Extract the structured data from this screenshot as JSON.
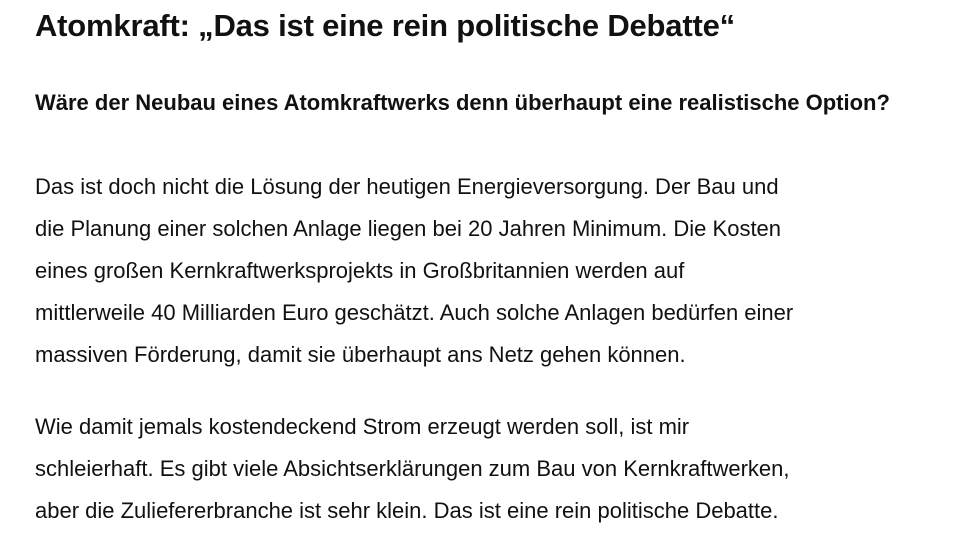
{
  "article": {
    "headline": "Atomkraft: „Das ist eine rein politische Debatte“",
    "question": "Wäre der Neubau eines Atomkraftwerks denn überhaupt eine realistische Option?",
    "answer_paragraph_1_lines": [
      "Das ist doch nicht die Lösung der heutigen Energieversorgung. Der Bau und",
      "die Planung einer solchen Anlage liegen bei 20 Jahren Minimum. Die Kosten",
      "eines großen Kernkraftwerksprojekts in Großbritannien werden auf",
      "mittlerweile 40 Milliarden Euro geschätzt. Auch solche Anlagen bedürfen einer",
      "massiven Förderung, damit sie überhaupt ans Netz gehen können."
    ],
    "answer_paragraph_2_lines": [
      "Wie damit jemals kostendeckend Strom erzeugt werden soll, ist mir",
      "schleierhaft. Es gibt viele Absichtserklärungen zum Bau von Kernkraftwerken,",
      "aber die Zuliefererbranche ist sehr klein. Das ist eine rein politische Debatte."
    ]
  }
}
